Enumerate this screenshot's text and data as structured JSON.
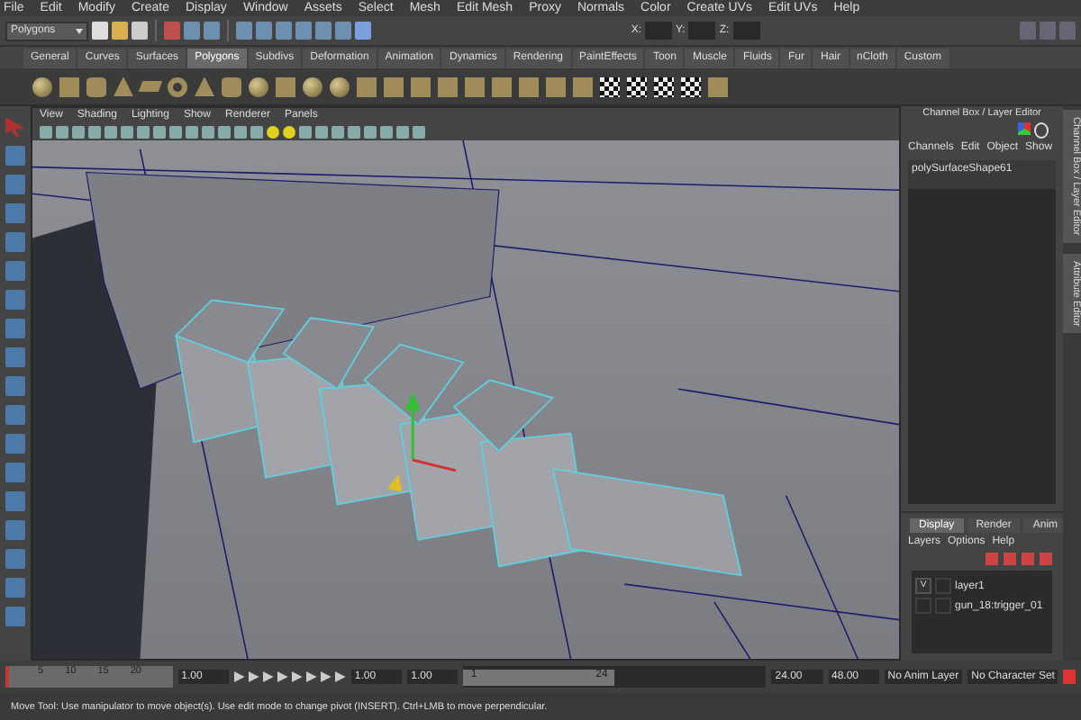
{
  "menu_bar": [
    "File",
    "Edit",
    "Modify",
    "Create",
    "Display",
    "Window",
    "Assets",
    "Select",
    "Mesh",
    "Edit Mesh",
    "Proxy",
    "Normals",
    "Color",
    "Create UVs",
    "Edit UVs",
    "Help"
  ],
  "status_line": {
    "mode_menu": "Polygons",
    "coordinate_labels": [
      "X:",
      "Y:",
      "Z:"
    ]
  },
  "shelf": {
    "tabs": [
      {
        "label": "General",
        "selected": false
      },
      {
        "label": "Curves",
        "selected": false
      },
      {
        "label": "Surfaces",
        "selected": false
      },
      {
        "label": "Polygons",
        "selected": true
      },
      {
        "label": "Subdivs",
        "selected": false
      },
      {
        "label": "Deformation",
        "selected": false
      },
      {
        "label": "Animation",
        "selected": false
      },
      {
        "label": "Dynamics",
        "selected": false
      },
      {
        "label": "Rendering",
        "selected": false
      },
      {
        "label": "PaintEffects",
        "selected": false
      },
      {
        "label": "Toon",
        "selected": false
      },
      {
        "label": "Muscle",
        "selected": false
      },
      {
        "label": "Fluids",
        "selected": false
      },
      {
        "label": "Fur",
        "selected": false
      },
      {
        "label": "Hair",
        "selected": false
      },
      {
        "label": "nCloth",
        "selected": false
      },
      {
        "label": "Custom",
        "selected": false
      }
    ]
  },
  "viewport": {
    "panel_menu": [
      "View",
      "Shading",
      "Lighting",
      "Show",
      "Renderer",
      "Panels"
    ]
  },
  "channel_box": {
    "title": "Channel Box / Layer Editor",
    "menu": [
      "Channels",
      "Edit",
      "Object",
      "Show"
    ],
    "object_name": "polySurfaceShape61"
  },
  "side_tabs": [
    "Channel Box / Layer Editor",
    "Attribute Editor"
  ],
  "layer_editor": {
    "tabs": [
      {
        "label": "Display",
        "selected": true
      },
      {
        "label": "Render",
        "selected": false
      },
      {
        "label": "Anim",
        "selected": false
      }
    ],
    "menu": [
      "Layers",
      "Options",
      "Help"
    ],
    "layers": [
      {
        "visible": true,
        "visible_mark": "V",
        "name": "layer1"
      },
      {
        "visible": false,
        "name": "gun_18:trigger_01"
      }
    ]
  },
  "time_slider": {
    "ticks": [
      "5",
      "10",
      "15",
      "20"
    ],
    "level": 0,
    "current_time": "1.00"
  },
  "range_slider": {
    "level": 0.5,
    "start": "1.00",
    "playback_start": "1.00",
    "range_start": "1",
    "range_end": "24",
    "playback_end": "24.00",
    "end": "48.00",
    "anim_layer": "No Anim Layer",
    "character_set": "No Character Set"
  },
  "help_line": "Move Tool: Use manipulator to move object(s). Use edit mode to change pivot (INSERT). Ctrl+LMB to move perpendicular."
}
